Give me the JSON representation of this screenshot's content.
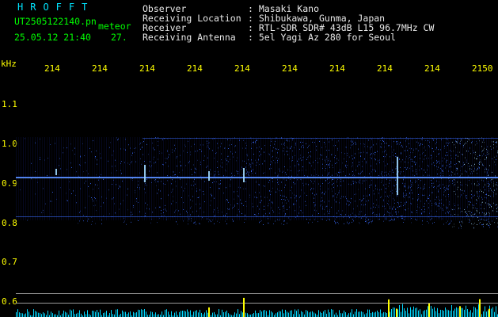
{
  "header": {
    "brand": "HROFFT",
    "filename": "UT2505122140.pn",
    "tag": "meteor",
    "datetime": "25.05.12 21:40",
    "count": "27.",
    "fields": [
      {
        "label": "Observer",
        "value": ": Masaki Kano"
      },
      {
        "label": "Receiving Location",
        "value": ": Shibukawa, Gunma, Japan"
      },
      {
        "label": "Receiver",
        "value": ": RTL-SDR SDR# 43dB L15 96.7MHz CW"
      },
      {
        "label": "Receiving Antenna",
        "value": ": 5el Yagi Az 280 for Seoul"
      }
    ]
  },
  "yaxis": {
    "unit": "kHz",
    "ticks": [
      "1.1",
      "1.0",
      "0.9",
      "0.8",
      "0.7",
      "0.6"
    ]
  },
  "xaxis": {
    "ticks": [
      "214",
      "214",
      "214",
      "214",
      "214",
      "214",
      "214",
      "214",
      "214",
      "2150"
    ]
  },
  "colors": {
    "background": "#000000",
    "signal": "#3a6cff",
    "bright": "#9fd8ff",
    "yellow": "#ffff00",
    "green": "#00ff00"
  }
}
